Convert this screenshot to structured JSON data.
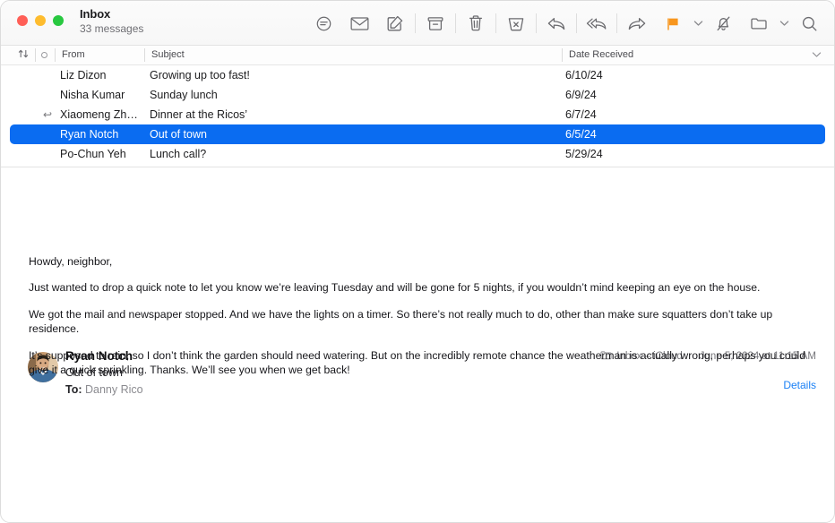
{
  "window": {
    "title": "Inbox",
    "subtitle": "33 messages"
  },
  "toolbar": {
    "buttons": [
      {
        "name": "filter-icon",
        "label": "Filter"
      },
      {
        "name": "mark-unread-icon",
        "label": "Mark as Unread"
      },
      {
        "name": "compose-icon",
        "label": "New Message"
      },
      {
        "name": "archive-icon",
        "label": "Archive"
      },
      {
        "name": "trash-icon",
        "label": "Delete"
      },
      {
        "name": "junk-icon",
        "label": "Move to Junk"
      },
      {
        "name": "reply-icon",
        "label": "Reply"
      },
      {
        "name": "reply-all-icon",
        "label": "Reply All"
      },
      {
        "name": "forward-icon",
        "label": "Forward"
      },
      {
        "name": "flag-icon",
        "label": "Flag"
      },
      {
        "name": "mute-icon",
        "label": "Mute"
      },
      {
        "name": "move-folder-icon",
        "label": "Move"
      },
      {
        "name": "search-icon",
        "label": "Search"
      }
    ],
    "flag_color": "#f8961e"
  },
  "list": {
    "columns": {
      "sort": "⇅",
      "unread": "",
      "from": "From",
      "subject": "Subject",
      "date": "Date Received"
    },
    "rows": [
      {
        "replied": "",
        "from": "Liz Dizon",
        "subject": "Growing up too fast!",
        "date": "6/10/24",
        "selected": false
      },
      {
        "replied": "",
        "from": "Nisha Kumar",
        "subject": "Sunday lunch",
        "date": "6/9/24",
        "selected": false
      },
      {
        "replied": "↩",
        "from": "Xiaomeng Zh…",
        "subject": "Dinner at the Ricos’",
        "date": "6/7/24",
        "selected": false
      },
      {
        "replied": "",
        "from": "Ryan Notch",
        "subject": "Out of town",
        "date": "6/5/24",
        "selected": true
      },
      {
        "replied": "",
        "from": "Po-Chun Yeh",
        "subject": "Lunch call?",
        "date": "5/29/24",
        "selected": false
      }
    ],
    "selection_color": "#0a6cf1"
  },
  "message": {
    "sender": "Ryan Notch",
    "subject": "Out of town",
    "to_label": "To:",
    "to_recipient": "Danny Rico",
    "mailbox": "Inbox – iCloud",
    "date": "June 5, 2024 at 11:15 AM",
    "details_label": "Details",
    "details_color": "#1a80f5",
    "body": [
      "Howdy, neighbor,",
      "Just wanted to drop a quick note to let you know we’re leaving Tuesday and will be gone for 5 nights, if you wouldn’t mind keeping an eye on the house.",
      "We got the mail and newspaper stopped. And we have the lights on a timer. So there’s not really much to do, other than make sure squatters don’t take up residence.",
      "It’s supposed to rain, so I don’t think the garden should need watering. But on the incredibly remote chance the weatherman is actually wrong, perhaps you could give it a quick sprinkling. Thanks. We’ll see you when we get back!"
    ]
  }
}
